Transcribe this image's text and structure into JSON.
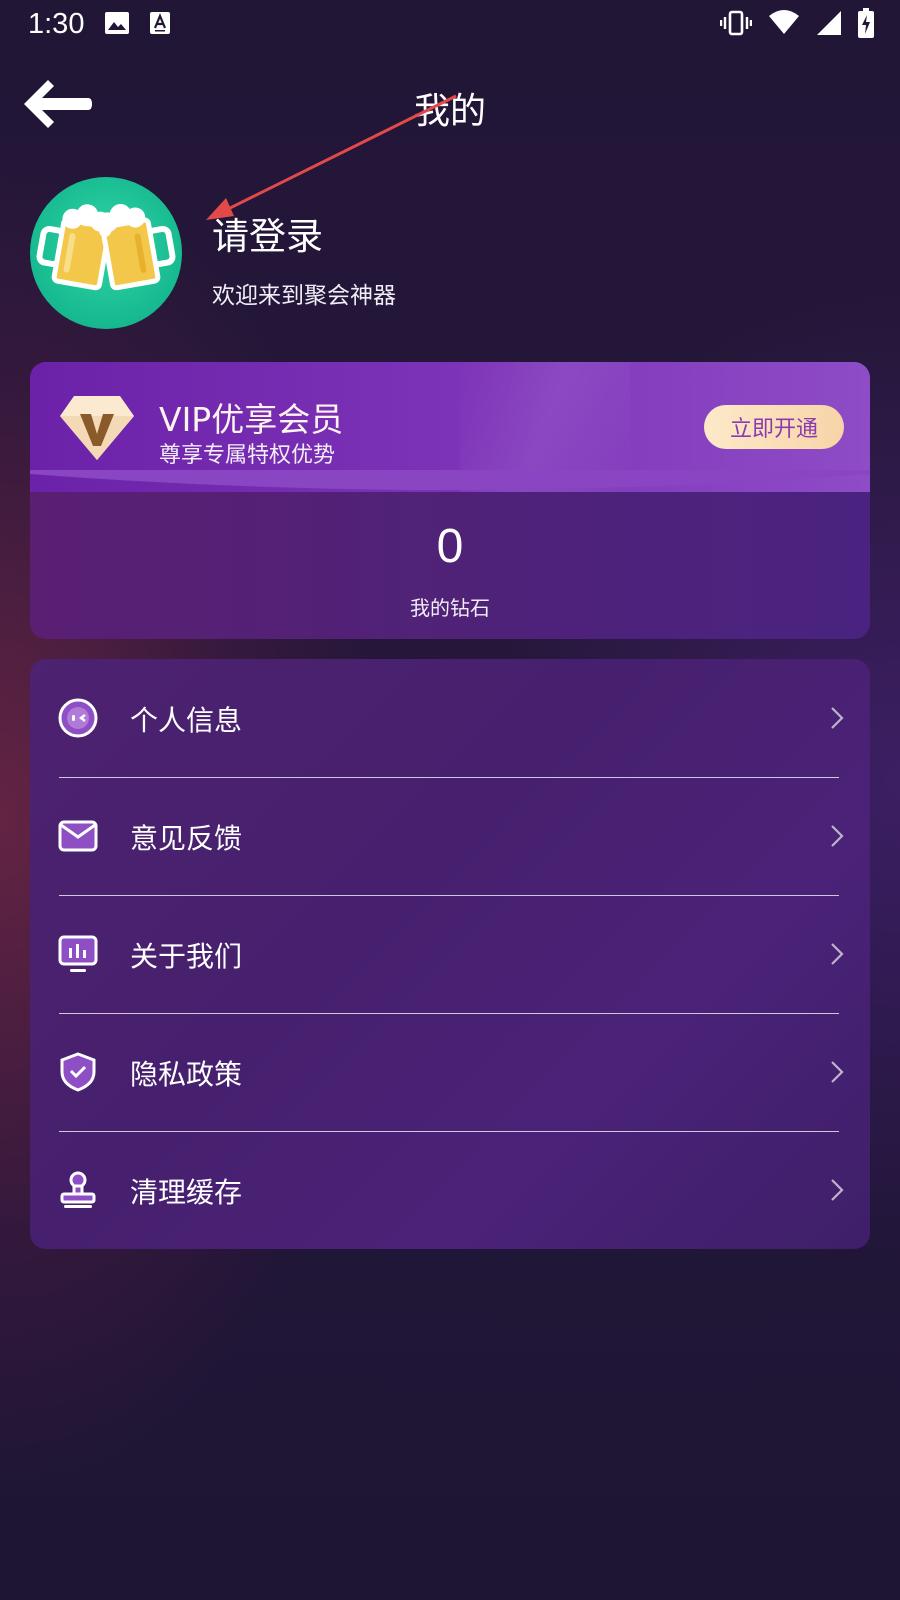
{
  "status_bar": {
    "time": "1:30",
    "left_icons": [
      "image-icon",
      "font-icon"
    ],
    "right_icons": [
      "vibrate-icon",
      "wifi-icon",
      "signal-icon",
      "battery-charging-icon"
    ]
  },
  "header": {
    "title": "我的",
    "back_icon": "back-arrow-icon"
  },
  "profile": {
    "login_prompt": "请登录",
    "welcome": "欢迎来到聚会神器",
    "avatar_icon": "beer-mugs-icon"
  },
  "vip": {
    "title": "VIP优享会员",
    "subtitle": "尊享专属特权优势",
    "button_label": "立即开通",
    "diamond_count": "0",
    "diamond_label": "我的钻石"
  },
  "menu": {
    "items": [
      {
        "label": "个人信息",
        "icon": "face-icon"
      },
      {
        "label": "意见反馈",
        "icon": "mail-icon"
      },
      {
        "label": "关于我们",
        "icon": "monitor-icon"
      },
      {
        "label": "隐私政策",
        "icon": "shield-check-icon"
      },
      {
        "label": "清理缓存",
        "icon": "stamp-icon"
      }
    ]
  },
  "colors": {
    "background": "#221637",
    "card_purple": "#4d2270",
    "vip_button_bg": "#fde9c9",
    "vip_button_text": "#8a3bb1",
    "annotation_arrow": "#e24a4a",
    "avatar_green": "#1fc599"
  }
}
